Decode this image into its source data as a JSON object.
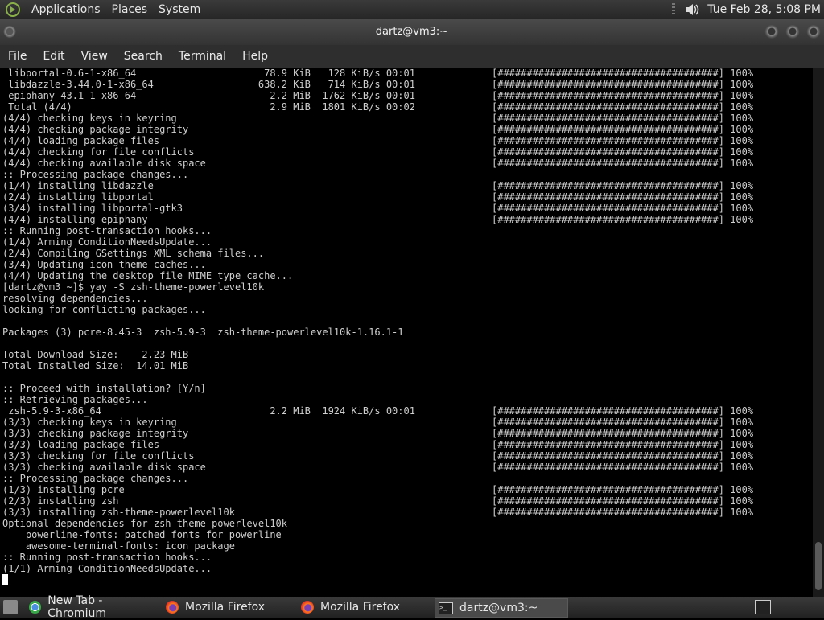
{
  "top_panel": {
    "menus": [
      "Applications",
      "Places",
      "System"
    ],
    "clock": "Tue Feb 28,  5:08 PM"
  },
  "window": {
    "title": "dartz@vm3:~"
  },
  "menubar": [
    "File",
    "Edit",
    "View",
    "Search",
    "Terminal",
    "Help"
  ],
  "terminal": {
    "lines": [
      " libportal-0.6-1-x86_64                      78.9 KiB   128 KiB/s 00:01",
      " libdazzle-3.44.0-1-x86_64                  638.2 KiB   714 KiB/s 00:01",
      " epiphany-43.1-1-x86_64                       2.2 MiB  1762 KiB/s 00:01",
      " Total (4/4)                                  2.9 MiB  1801 KiB/s 00:02",
      "(4/4) checking keys in keyring",
      "(4/4) checking package integrity",
      "(4/4) loading package files",
      "(4/4) checking for file conflicts",
      "(4/4) checking available disk space",
      ":: Processing package changes...",
      "(1/4) installing libdazzle",
      "(2/4) installing libportal",
      "(3/4) installing libportal-gtk3",
      "(4/4) installing epiphany",
      ":: Running post-transaction hooks...",
      "(1/4) Arming ConditionNeedsUpdate...",
      "(2/4) Compiling GSettings XML schema files...",
      "(3/4) Updating icon theme caches...",
      "(4/4) Updating the desktop file MIME type cache...",
      "[dartz@vm3 ~]$ yay -S zsh-theme-powerlevel10k",
      "resolving dependencies...",
      "looking for conflicting packages...",
      "",
      "Packages (3) pcre-8.45-3  zsh-5.9-3  zsh-theme-powerlevel10k-1.16.1-1",
      "",
      "Total Download Size:    2.23 MiB",
      "Total Installed Size:  14.01 MiB",
      "",
      ":: Proceed with installation? [Y/n]",
      ":: Retrieving packages...",
      " zsh-5.9-3-x86_64                             2.2 MiB  1924 KiB/s 00:01",
      "(3/3) checking keys in keyring",
      "(3/3) checking package integrity",
      "(3/3) loading package files",
      "(3/3) checking for file conflicts",
      "(3/3) checking available disk space",
      ":: Processing package changes...",
      "(1/3) installing pcre",
      "(2/3) installing zsh",
      "(3/3) installing zsh-theme-powerlevel10k",
      "Optional dependencies for zsh-theme-powerlevel10k",
      "    powerline-fonts: patched fonts for powerline",
      "    awesome-terminal-fonts: icon package",
      ":: Running post-transaction hooks...",
      "(1/1) Arming ConditionNeedsUpdate..."
    ],
    "progress_bar": "[######################################] 100%",
    "progress_lines": [
      0,
      1,
      2,
      3,
      4,
      5,
      6,
      7,
      8,
      10,
      11,
      12,
      13,
      30,
      31,
      32,
      33,
      34,
      35,
      37,
      38,
      39
    ]
  },
  "taskbar": {
    "tasks": [
      {
        "label": "New Tab - Chromium",
        "icon": "chromium-icon",
        "active": false
      },
      {
        "label": "Mozilla Firefox",
        "icon": "firefox-icon",
        "active": false
      },
      {
        "label": "Mozilla Firefox",
        "icon": "firefox-icon",
        "active": false
      },
      {
        "label": "dartz@vm3:~",
        "icon": "terminal-icon",
        "active": true
      }
    ]
  }
}
